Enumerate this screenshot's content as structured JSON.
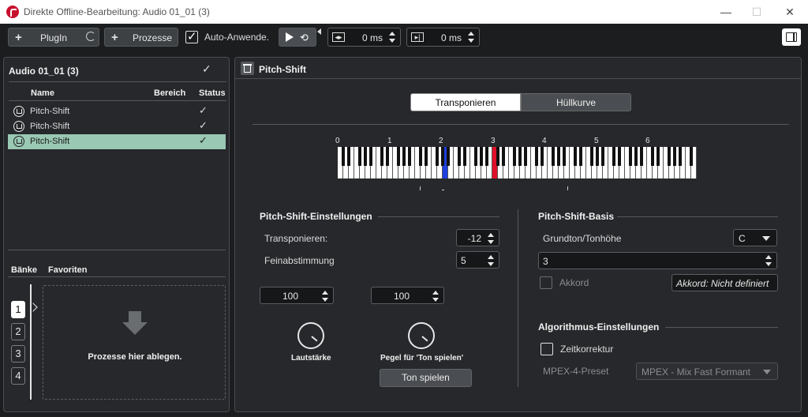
{
  "window": {
    "title": "Direkte Offline-Bearbeitung: Audio 01_01 (3)",
    "minimize": "—",
    "maximize": "☐",
    "close": "✕"
  },
  "toolbar": {
    "plugin_label": "PlugIn",
    "prozesse_label": "Prozesse",
    "auto_apply_label": "Auto-Anwende.",
    "auto_apply_checked": true,
    "pre_time": "0 ms",
    "post_time": "0 ms"
  },
  "left": {
    "header": "Audio 01_01 (3)",
    "columns": {
      "name": "Name",
      "range": "Bereich",
      "status": "Status"
    },
    "rows": [
      {
        "name": "Pitch-Shift",
        "status": "✓",
        "selected": false
      },
      {
        "name": "Pitch-Shift",
        "status": "✓",
        "selected": false
      },
      {
        "name": "Pitch-Shift",
        "status": "✓",
        "selected": true
      }
    ],
    "tabs": {
      "banks": "Bänke",
      "favorites": "Favoriten"
    },
    "banks": [
      "1",
      "2",
      "3",
      "4"
    ],
    "drop_hint": "Prozesse hier ablegen."
  },
  "right": {
    "header": "Pitch-Shift",
    "tabs": {
      "transpose": "Transponieren",
      "envelope": "Hüllkurve"
    },
    "octave_labels": [
      "0",
      "1",
      "2",
      "3",
      "4",
      "5",
      "6"
    ],
    "settings": {
      "title": "Pitch-Shift-Einstellungen",
      "transpose_label": "Transponieren:",
      "transpose_value": "-12",
      "finetune_label": "Feinabstimmung",
      "finetune_value": "5",
      "volume_value": "100",
      "level_value": "100",
      "volume_label": "Lautstärke",
      "level_label": "Pegel für 'Ton spielen'",
      "play_button": "Ton spielen"
    },
    "basis": {
      "title": "Pitch-Shift-Basis",
      "root_label": "Grundton/Tonhöhe",
      "root_value": "C",
      "octave_value": "3",
      "chord_label": "Akkord",
      "chord_button": "Akkord: Nicht definiert"
    },
    "algorithm": {
      "title": "Algorithmus-Einstellungen",
      "time_correction_label": "Zeitkorrektur",
      "preset_label": "MPEX-4-Preset",
      "preset_value": "MPEX - Mix Fast Formant"
    }
  },
  "colors": {
    "accent_blue": "#1f3fe0",
    "accent_red": "#e0102a",
    "selection": "#99c8b4"
  }
}
